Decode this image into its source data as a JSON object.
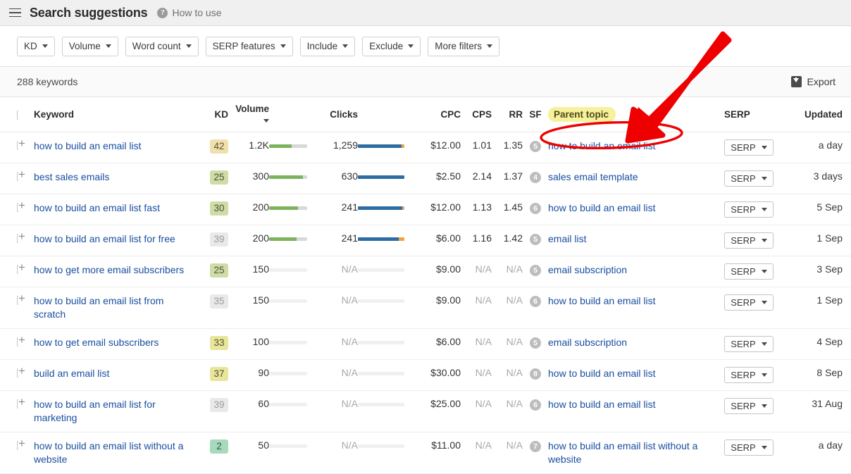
{
  "header": {
    "menu_icon": "hamburger-icon",
    "title": "Search suggestions",
    "help_icon": "question-mark-icon",
    "help_label": "How to use"
  },
  "filters": [
    {
      "label": "KD"
    },
    {
      "label": "Volume"
    },
    {
      "label": "Word count"
    },
    {
      "label": "SERP features"
    },
    {
      "label": "Include"
    },
    {
      "label": "Exclude"
    },
    {
      "label": "More filters"
    }
  ],
  "toolbar": {
    "count_label": "288 keywords",
    "export_label": "Export",
    "export_icon": "download-icon"
  },
  "columns": {
    "keyword": "Keyword",
    "kd": "KD",
    "volume": "Volume",
    "clicks": "Clicks",
    "cpc": "CPC",
    "cps": "CPS",
    "rr": "RR",
    "sf": "SF",
    "parent_topic": "Parent topic",
    "serp": "SERP",
    "updated": "Updated"
  },
  "serp_button_label": "SERP",
  "rows": [
    {
      "keyword": "how to build an email list",
      "kd": "42",
      "kd_color": "kd-tan",
      "volume": "1.2K",
      "volume_bar": 60,
      "clicks": "1,259",
      "clicks_bar": 96,
      "clicks_tip": 6,
      "cpc": "$12.00",
      "cps": "1.01",
      "rr": "1.35",
      "sf": "5",
      "parent_topic": "how to build an email list",
      "serp": "SERP",
      "updated": "a day"
    },
    {
      "keyword": "best sales emails",
      "kd": "25",
      "kd_color": "kd-green",
      "volume": "300",
      "volume_bar": 89,
      "clicks": "630",
      "clicks_bar": 100,
      "clicks_tip": 0,
      "cpc": "$2.50",
      "cps": "2.14",
      "rr": "1.37",
      "sf": "4",
      "parent_topic": "sales email template",
      "serp": "SERP",
      "updated": "3 days"
    },
    {
      "keyword": "how to build an email list fast",
      "kd": "30",
      "kd_color": "kd-green",
      "volume": "200",
      "volume_bar": 76,
      "clicks": "241",
      "clicks_bar": 95,
      "clicks_tip": 5,
      "cpc": "$12.00",
      "cps": "1.13",
      "rr": "1.45",
      "sf": "6",
      "parent_topic": "how to build an email list",
      "serp": "SERP",
      "updated": "5 Sep"
    },
    {
      "keyword": "how to build an email list for free",
      "kd": "39",
      "kd_color": "kd-gray",
      "volume": "200",
      "volume_bar": 72,
      "clicks": "241",
      "clicks_bar": 88,
      "clicks_tip": 12,
      "cpc": "$6.00",
      "cps": "1.16",
      "rr": "1.42",
      "sf": "5",
      "parent_topic": "email list",
      "serp": "SERP",
      "updated": "1 Sep"
    },
    {
      "keyword": "how to get more email subscribers",
      "kd": "25",
      "kd_color": "kd-green",
      "volume": "150",
      "volume_bar": 0,
      "clicks": "N/A",
      "clicks_bar": 0,
      "clicks_tip": 0,
      "cpc": "$9.00",
      "cps": "N/A",
      "rr": "N/A",
      "sf": "5",
      "parent_topic": "email subscription",
      "serp": "SERP",
      "updated": "3 Sep"
    },
    {
      "keyword": "how to build an email list from scratch",
      "kd": "35",
      "kd_color": "kd-gray",
      "volume": "150",
      "volume_bar": 0,
      "clicks": "N/A",
      "clicks_bar": 0,
      "clicks_tip": 0,
      "cpc": "$9.00",
      "cps": "N/A",
      "rr": "N/A",
      "sf": "6",
      "parent_topic": "how to build an email list",
      "serp": "SERP",
      "updated": "1 Sep"
    },
    {
      "keyword": "how to get email subscribers",
      "kd": "33",
      "kd_color": "kd-yellow",
      "volume": "100",
      "volume_bar": 0,
      "clicks": "N/A",
      "clicks_bar": 0,
      "clicks_tip": 0,
      "cpc": "$6.00",
      "cps": "N/A",
      "rr": "N/A",
      "sf": "5",
      "parent_topic": "email subscription",
      "serp": "SERP",
      "updated": "4 Sep"
    },
    {
      "keyword": "build an email list",
      "kd": "37",
      "kd_color": "kd-yellow",
      "volume": "90",
      "volume_bar": 0,
      "clicks": "N/A",
      "clicks_bar": 0,
      "clicks_tip": 0,
      "cpc": "$30.00",
      "cps": "N/A",
      "rr": "N/A",
      "sf": "8",
      "parent_topic": "how to build an email list",
      "serp": "SERP",
      "updated": "8 Sep"
    },
    {
      "keyword": "how to build an email list for marketing",
      "kd": "39",
      "kd_color": "kd-gray",
      "volume": "60",
      "volume_bar": 0,
      "clicks": "N/A",
      "clicks_bar": 0,
      "clicks_tip": 0,
      "cpc": "$25.00",
      "cps": "N/A",
      "rr": "N/A",
      "sf": "6",
      "parent_topic": "how to build an email list",
      "serp": "SERP",
      "updated": "31 Aug"
    },
    {
      "keyword": "how to build an email list without a website",
      "kd": "2",
      "kd_color": "kd-teal",
      "volume": "50",
      "volume_bar": 0,
      "clicks": "N/A",
      "clicks_bar": 0,
      "clicks_tip": 0,
      "cpc": "$11.00",
      "cps": "N/A",
      "rr": "N/A",
      "sf": "7",
      "parent_topic": "how to build an email list without a website",
      "serp": "SERP",
      "updated": "a day"
    }
  ],
  "annotation": {
    "color": "#ee0000",
    "arrow_icon": "red-arrow-annotation",
    "ellipse_icon": "red-ellipse-annotation",
    "highlight_color": "#f7f19b"
  }
}
